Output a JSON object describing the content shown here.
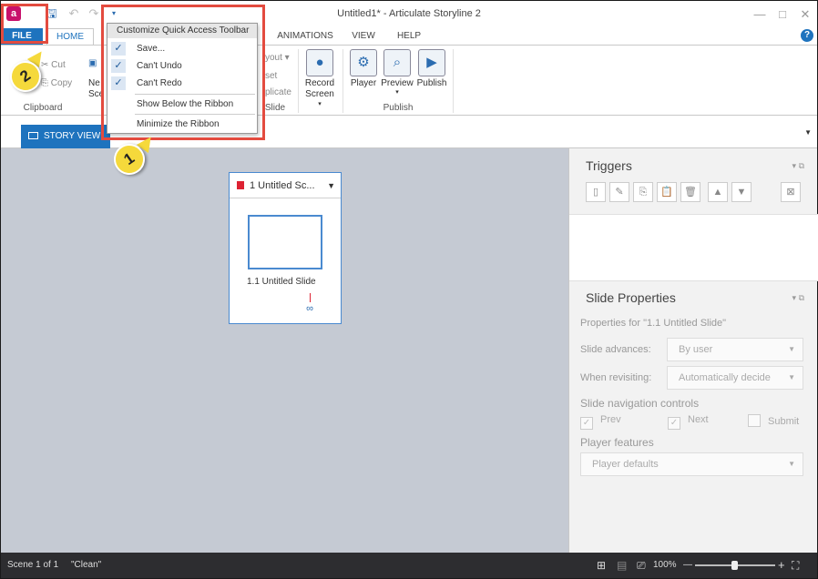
{
  "window": {
    "title": "Untitled1* - Articulate Storyline 2",
    "logo_letter": "a",
    "min_glyph": "—",
    "max_glyph": "□",
    "close_glyph": "✕"
  },
  "tabs": [
    "FILE",
    "HOME",
    "ANIMATIONS",
    "VIEW",
    "HELP"
  ],
  "help_glyph": "?",
  "ribbon": {
    "clipboard": {
      "cut": "Cut",
      "copy": "Copy",
      "group_label": "Clipboard",
      "new_scene_partial": "Ne\nSce"
    },
    "slide": {
      "layout_partial": "yout",
      "reset_partial": "set",
      "duplicate_partial": "plicate",
      "group_label": "Slide"
    },
    "record_screen": "Record Screen",
    "player": "Player",
    "preview": "Preview",
    "publish": "Publish",
    "publish_group": "Publish"
  },
  "qat_menu": {
    "header": "Customize Quick Access Toolbar",
    "items": [
      {
        "label": "Save...",
        "checked": true
      },
      {
        "label": "Can't Undo",
        "checked": true
      },
      {
        "label": "Can't Redo",
        "checked": true
      }
    ],
    "show_below": "Show Below the Ribbon",
    "minimize": "Minimize the Ribbon"
  },
  "view_tab": "STORY VIEW",
  "scene": {
    "title": "1 Untitled Sc...",
    "slide_label": "1.1 Untitled Slide"
  },
  "triggers_panel": {
    "title": "Triggers"
  },
  "slide_properties": {
    "title": "Slide Properties",
    "properties_for": "Properties for \"1.1 Untitled Slide\"",
    "slide_advances_label": "Slide advances:",
    "slide_advances_value": "By user",
    "when_revisiting_label": "When revisiting:",
    "when_revisiting_value": "Automatically decide",
    "nav_controls_label": "Slide navigation controls",
    "prev": "Prev",
    "next": "Next",
    "submit": "Submit",
    "player_features_label": "Player features",
    "player_defaults": "Player defaults"
  },
  "status": {
    "scene_info": "Scene 1 of 1",
    "theme": "\"Clean\"",
    "zoom": "100%",
    "zoom_minus": "—",
    "zoom_plus": "+"
  },
  "callouts": {
    "one": "1",
    "two": "2"
  },
  "colors": {
    "accent": "#1e73be",
    "callout_border": "#e34b3f",
    "badge": "#f5d93b",
    "statusbar": "#2d2d30"
  }
}
